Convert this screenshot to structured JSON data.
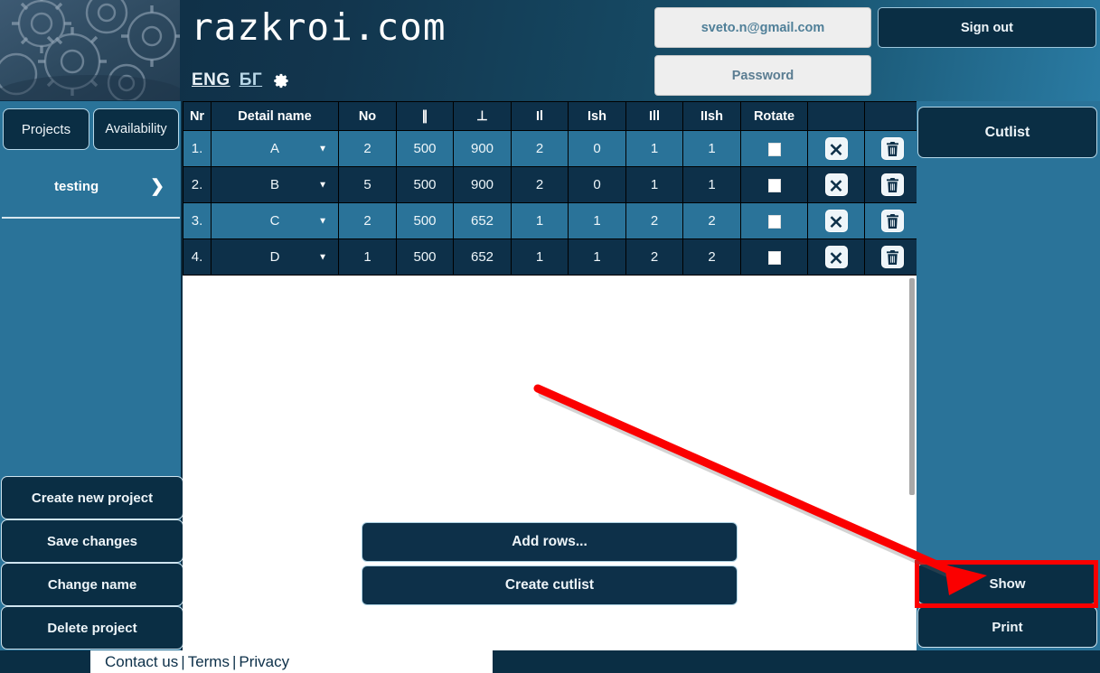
{
  "header": {
    "brand": "razkroi.com",
    "lang_eng": "ENG",
    "lang_bg": "БГ",
    "settings_icon": "gear-icon",
    "logo_image": "gears-photo",
    "email_value": "sveto.n@gmail.com",
    "password_placeholder": "Password",
    "password_value": "Password",
    "sign_out_label": "Sign out"
  },
  "sidebar": {
    "tab_projects": "Projects",
    "tab_availability": "Availability",
    "projects": [
      {
        "name": "testing",
        "chevron": "chevron-right-icon"
      }
    ],
    "buttons": [
      "Create new project",
      "Save changes",
      "Change name",
      "Delete project"
    ]
  },
  "table": {
    "headers": [
      "Nr",
      "Detail name",
      "No",
      "∥",
      "⊥",
      "Il",
      "Ish",
      "Ill",
      "IIsh",
      "Rotate",
      "",
      ""
    ],
    "rows": [
      {
        "nr": "1.",
        "name": "A",
        "no": "2",
        "par": "500",
        "perp": "900",
        "il": "2",
        "ish": "0",
        "ill": "1",
        "iish": "1",
        "rotate": false
      },
      {
        "nr": "2.",
        "name": "B",
        "no": "5",
        "par": "500",
        "perp": "900",
        "il": "2",
        "ish": "0",
        "ill": "1",
        "iish": "1",
        "rotate": false
      },
      {
        "nr": "3.",
        "name": "C",
        "no": "2",
        "par": "500",
        "perp": "652",
        "il": "1",
        "ish": "1",
        "ill": "2",
        "iish": "2",
        "rotate": false
      },
      {
        "nr": "4.",
        "name": "D",
        "no": "1",
        "par": "500",
        "perp": "652",
        "il": "1",
        "ish": "1",
        "ill": "2",
        "iish": "2",
        "rotate": false
      }
    ],
    "row_clear_icon": "clear-x-icon",
    "row_delete_icon": "trash-icon"
  },
  "main_actions": {
    "add_rows": "Add rows...",
    "create_cutlist": "Create cutlist"
  },
  "rightbar": {
    "cutlist_label": "Cutlist",
    "show_label": "Show",
    "print_label": "Print"
  },
  "footer": {
    "contact": "Contact us",
    "terms": "Terms",
    "privacy": "Privacy",
    "separator": "|"
  },
  "annotation": {
    "highlight_color": "#fb0000",
    "arrow_color": "#fb0000",
    "target": "Show"
  }
}
